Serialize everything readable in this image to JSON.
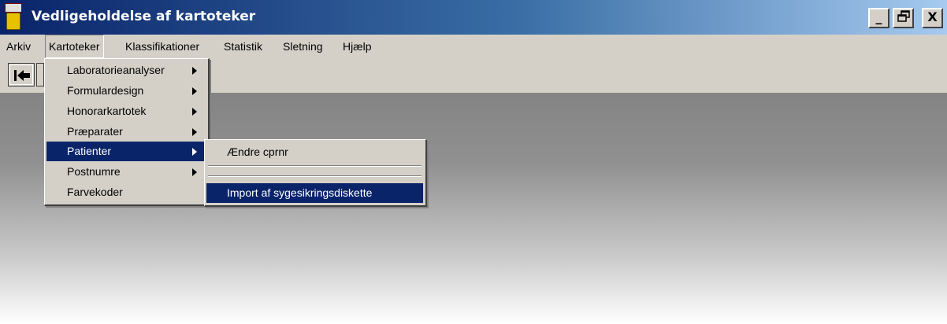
{
  "window": {
    "title": "Vedligeholdelse af kartoteker",
    "controls": {
      "minimize": "_",
      "restore": "🗗",
      "close": "X"
    }
  },
  "menubar": {
    "items": [
      "Arkiv",
      "Kartoteker",
      "Klassifikationer",
      "Statistik",
      "Sletning",
      "Hjælp"
    ],
    "open_item": "Kartoteker"
  },
  "toolbar": {
    "buttons": [
      {
        "icon": "arrow-left-to-bar-icon"
      }
    ]
  },
  "kartoteker_menu": {
    "items": [
      {
        "label": "Laboratorieanalyser",
        "submenu": true
      },
      {
        "label": "Formulardesign",
        "submenu": true
      },
      {
        "label": "Honorarkartotek",
        "submenu": true
      },
      {
        "label": "Præparater",
        "submenu": true
      },
      {
        "label": "Patienter",
        "submenu": true,
        "selected": true
      },
      {
        "label": "Postnumre",
        "submenu": true
      },
      {
        "label": "Farvekoder",
        "submenu": false
      }
    ]
  },
  "patienter_submenu": {
    "items": [
      {
        "label": "Ændre cprnr"
      },
      {
        "label": "Import af sygesikringsdiskette",
        "selected": true
      }
    ]
  },
  "colors": {
    "title_gradient_start": "#0a246a",
    "title_gradient_end": "#a6caf0",
    "menu_bg": "#d4d0c8",
    "highlight": "#0a246a"
  }
}
